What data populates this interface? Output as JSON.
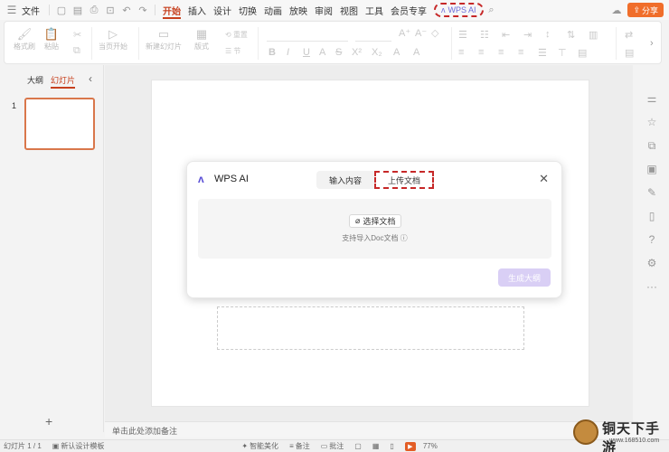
{
  "menubar": {
    "file_label": "文件",
    "tabs": [
      "开始",
      "插入",
      "设计",
      "切换",
      "动画",
      "放映",
      "审阅",
      "视图",
      "工具",
      "会员专享"
    ],
    "active_tab": "开始",
    "wps_ai_label": "WPS AI",
    "share_label": "分享"
  },
  "ribbon": {
    "format_painter": "格式刷",
    "paste": "粘贴",
    "play_from_current": "当页开始",
    "new_slide": "新建幻灯片",
    "layout": "版式",
    "reset": "重置",
    "section": "节"
  },
  "left_panel": {
    "outline_tab": "大纲",
    "slides_tab": "幻灯片",
    "slide_number": "1"
  },
  "notes": {
    "placeholder": "单击此处添加备注"
  },
  "statusbar": {
    "slide_position": "幻灯片 1 / 1",
    "design_template": "新认设计模板",
    "smart_beautify": "智能美化",
    "notes": "备注",
    "annotations": "批注",
    "zoom": "77%"
  },
  "dialog": {
    "title": "WPS AI",
    "tab_input": "输入内容",
    "tab_upload": "上传文档",
    "choose_doc": "选择文档",
    "hint": "支持导入Doc文档",
    "generate": "生成大纲"
  },
  "watermark": {
    "text": "铜天下手游",
    "url": "www.168510.com"
  },
  "colors": {
    "accent_orange": "#c7401e",
    "share_orange": "#f06e2b",
    "ai_purple": "#5a4fd6",
    "highlight_red": "#c62828",
    "generate_disabled": "#d9cff5"
  }
}
